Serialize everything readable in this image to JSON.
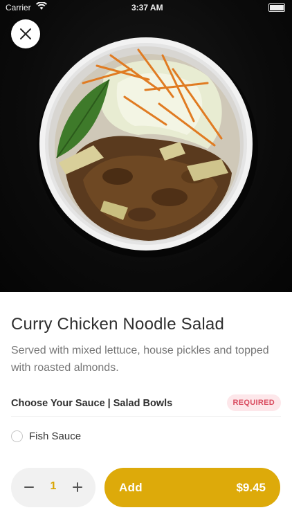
{
  "status_bar": {
    "carrier": "Carrier",
    "time": "3:37 AM"
  },
  "item": {
    "name": "Curry Chicken Noodle Salad",
    "description": "Served with mixed lettuce, house pickles and topped with roasted almonds."
  },
  "options_group": {
    "title": "Choose Your Sauce | Salad Bowls",
    "badge": "REQUIRED",
    "options": [
      {
        "label": "Fish Sauce",
        "selected": false
      }
    ]
  },
  "footer": {
    "quantity": "1",
    "add_label": "Add",
    "price": "$9.45"
  },
  "icons": {
    "close": "close-icon",
    "minus": "minus-icon",
    "plus": "plus-icon",
    "radio": "radio-unchecked-icon",
    "wifi": "wifi-icon",
    "battery": "battery-icon"
  },
  "colors": {
    "accent": "#ddaa0a",
    "quantity_text": "#d9a400",
    "badge_bg": "#fde7ea",
    "badge_text": "#d94b5f",
    "hero_bg": "#0b0b0b"
  }
}
